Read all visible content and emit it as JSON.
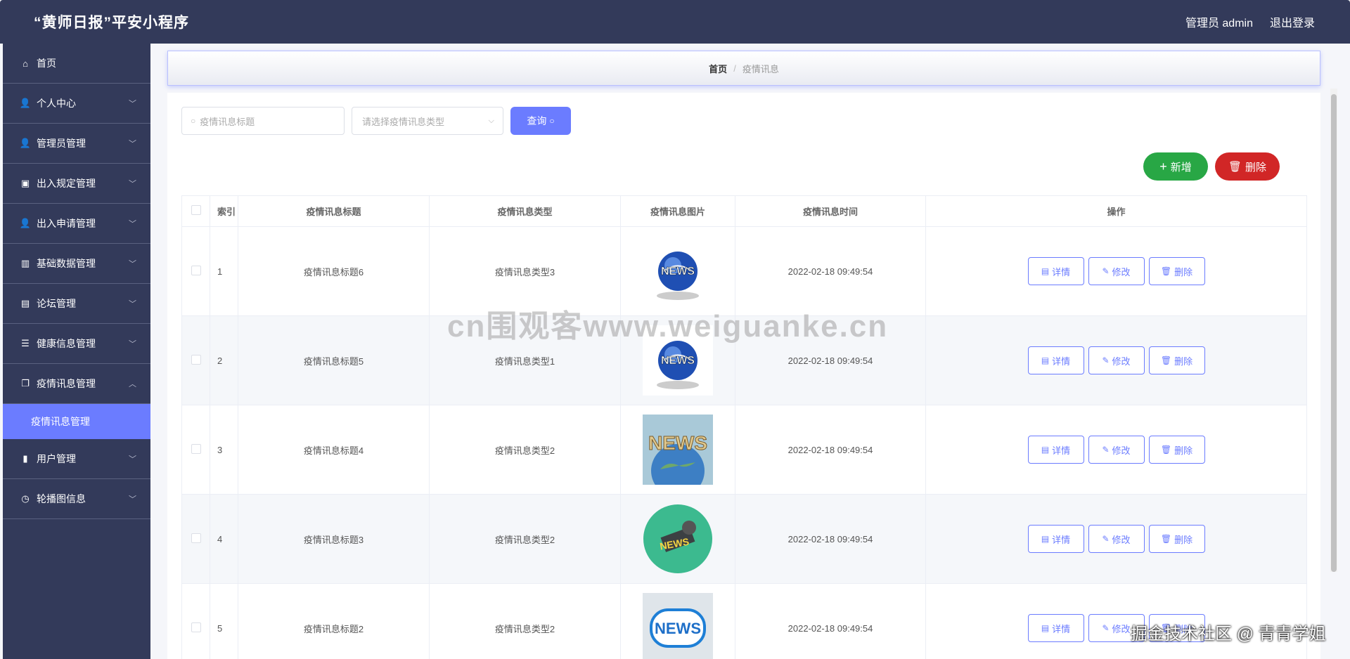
{
  "app": {
    "title": "“黄师日报”平安小程序"
  },
  "header": {
    "user_label": "管理员 admin",
    "logout_label": "退出登录"
  },
  "sidebar": {
    "items": [
      {
        "label": "首页",
        "icon": "home-icon",
        "glyph": "⌂",
        "expandable": false
      },
      {
        "label": "个人中心",
        "icon": "user-icon",
        "glyph": "👤",
        "expandable": true
      },
      {
        "label": "管理员管理",
        "icon": "user-icon",
        "glyph": "👤",
        "expandable": true
      },
      {
        "label": "出入规定管理",
        "icon": "briefcase-icon",
        "glyph": "▣",
        "expandable": true
      },
      {
        "label": "出入申请管理",
        "icon": "user-icon",
        "glyph": "👤",
        "expandable": true
      },
      {
        "label": "基础数据管理",
        "icon": "bar-chart-icon",
        "glyph": "▥",
        "expandable": true
      },
      {
        "label": "论坛管理",
        "icon": "clipboard-icon",
        "glyph": "▤",
        "expandable": true
      },
      {
        "label": "健康信息管理",
        "icon": "sliders-icon",
        "glyph": "☰",
        "expandable": true
      },
      {
        "label": "疫情讯息管理",
        "icon": "copy-icon",
        "glyph": "❐",
        "expandable": true,
        "expanded": true
      },
      {
        "label": "用户管理",
        "icon": "book-icon",
        "glyph": "▮",
        "expandable": true
      },
      {
        "label": "轮播图信息",
        "icon": "clock-icon",
        "glyph": "◷",
        "expandable": true
      }
    ],
    "submenu_active": "疫情讯息管理"
  },
  "breadcrumb": {
    "home": "首页",
    "sep": "/",
    "current": "疫情讯息"
  },
  "search": {
    "title_placeholder": "疫情讯息标题",
    "type_placeholder": "请选择疫情讯息类型",
    "query_label": "查询"
  },
  "actions": {
    "add_label": "新增",
    "delete_label": "删除"
  },
  "table": {
    "columns": [
      "索引",
      "疫情讯息标题",
      "疫情讯息类型",
      "疫情讯息图片",
      "疫情讯息时间",
      "操作"
    ],
    "rows": [
      {
        "index": "1",
        "title": "疫情讯息标题6",
        "type": "疫情讯息类型3",
        "image": "globe-news-icon",
        "time": "2022-02-18 09:49:54"
      },
      {
        "index": "2",
        "title": "疫情讯息标题5",
        "type": "疫情讯息类型1",
        "image": "globe-news-icon",
        "time": "2022-02-18 09:49:54"
      },
      {
        "index": "3",
        "title": "疫情讯息标题4",
        "type": "疫情讯息类型2",
        "image": "world-news-icon",
        "time": "2022-02-18 09:49:54"
      },
      {
        "index": "4",
        "title": "疫情讯息标题3",
        "type": "疫情讯息类型2",
        "image": "microphone-news-icon",
        "time": "2022-02-18 09:49:54"
      },
      {
        "index": "5",
        "title": "疫情讯息标题2",
        "type": "疫情讯息类型2",
        "image": "news-badge-icon",
        "time": "2022-02-18 09:49:54"
      }
    ],
    "op_labels": {
      "detail": "详情",
      "edit": "修改",
      "delete": "删除"
    }
  },
  "overlay": {
    "watermark": "cn围观客www.weiguanke.cn",
    "credit": "掘金技术社区 @ 青青学姐"
  },
  "colors": {
    "sidebar_bg": "#333a5a",
    "accent": "#6b7cff",
    "add": "#28a745",
    "delete": "#d12626"
  }
}
